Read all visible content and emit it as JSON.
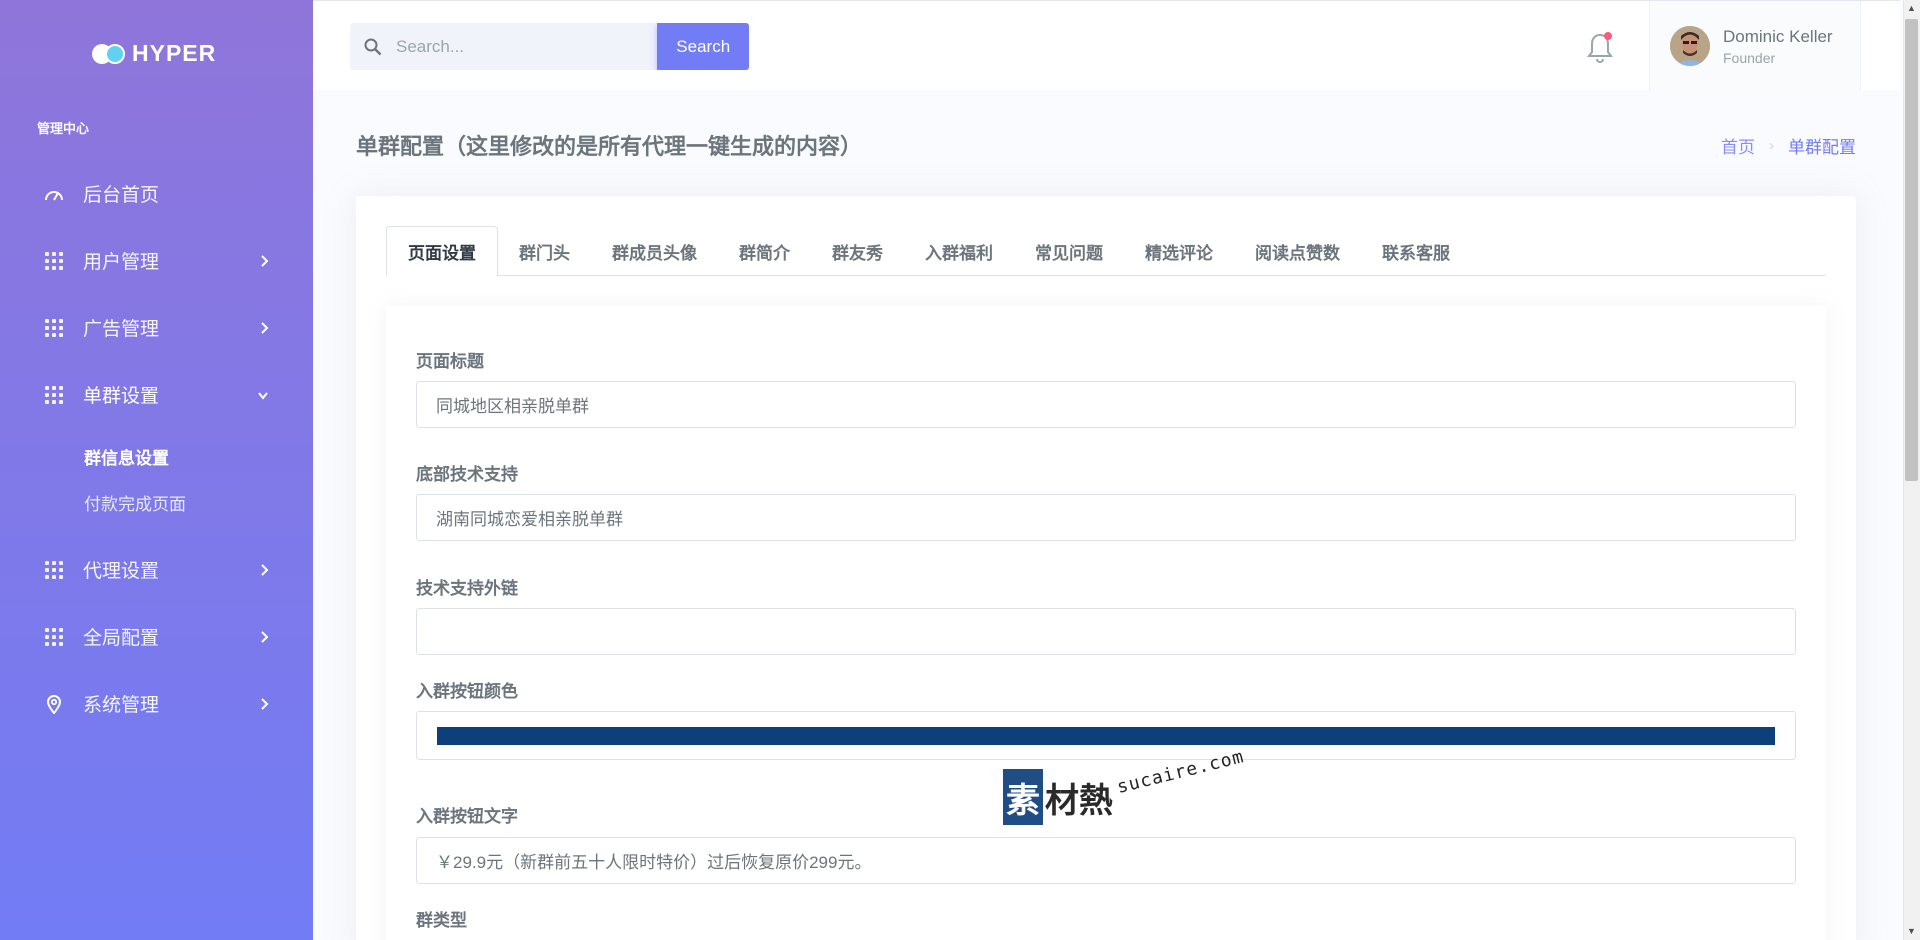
{
  "brand": {
    "logo_text": "HYPER"
  },
  "sidebar": {
    "section_title": "管理中心",
    "items": [
      {
        "label": "后台首页",
        "icon": "dashboard-icon"
      },
      {
        "label": "用户管理",
        "icon": "grid-icon"
      },
      {
        "label": "广告管理",
        "icon": "grid-icon"
      },
      {
        "label": "单群设置",
        "icon": "grid-icon",
        "expanded": true
      },
      {
        "label": "代理设置",
        "icon": "grid-icon"
      },
      {
        "label": "全局配置",
        "icon": "grid-icon"
      },
      {
        "label": "系统管理",
        "icon": "map-pin-icon"
      }
    ],
    "submenu": [
      {
        "label": "群信息设置",
        "active": true
      },
      {
        "label": "付款完成页面"
      }
    ]
  },
  "topbar": {
    "search_placeholder": "Search...",
    "search_button": "Search",
    "user_name": "Dominic Keller",
    "user_role": "Founder"
  },
  "page": {
    "title": "单群配置（这里修改的是所有代理一键生成的内容）",
    "breadcrumb": [
      "首页",
      "单群配置"
    ]
  },
  "tabs": [
    "页面设置",
    "群门头",
    "群成员头像",
    "群简介",
    "群友秀",
    "入群福利",
    "常见问题",
    "精选评论",
    "阅读点赞数",
    "联系客服"
  ],
  "form": {
    "page_title_label": "页面标题",
    "page_title_value": "同城地区相亲脱单群",
    "footer_label": "底部技术支持",
    "footer_value": "湖南同城恋爱相亲脱单群",
    "link_label": "技术支持外链",
    "link_value": "",
    "btn_color_label": "入群按钮颜色",
    "btn_color_value": "#0d3f7b",
    "btn_text_label": "入群按钮文字",
    "btn_text_value": "￥29.9元（新群前五十人限时特价）过后恢复原价299元。",
    "group_type_label": "群类型"
  },
  "watermark": {
    "cn": "素材熱",
    "url": "sucaire.com"
  },
  "colors": {
    "primary": "#727cf5",
    "sidebar_top": "#8f75da",
    "sidebar_bottom": "#727cf5"
  }
}
